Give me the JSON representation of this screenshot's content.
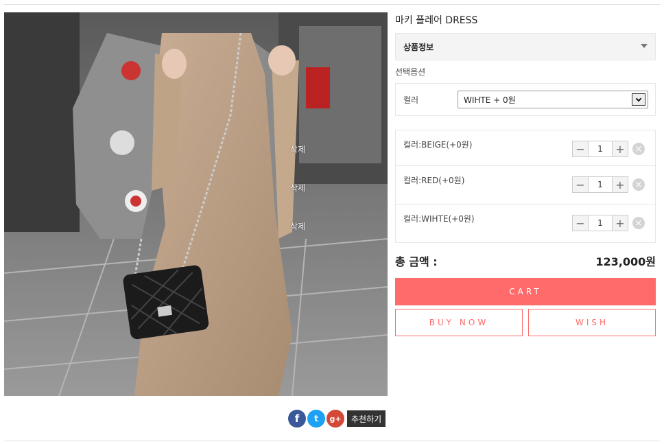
{
  "product": {
    "title": "마키 플레어 DRESS",
    "photo_alt": "product photo"
  },
  "photo_overlay": {
    "delete_labels": [
      "삭제",
      "삭제",
      "삭제"
    ]
  },
  "info_toggle": {
    "label": "상품정보"
  },
  "options": {
    "heading": "선택옵션",
    "color_label": "컬러",
    "color_selected": "WIHTE  + 0원"
  },
  "selected_items": [
    {
      "name": "컬러:BEIGE(+0원)",
      "qty": "1",
      "minus": "−",
      "plus": "+",
      "remove": "×"
    },
    {
      "name": "컬러:RED(+0원)",
      "qty": "1",
      "minus": "−",
      "plus": "+",
      "remove": "×"
    },
    {
      "name": "컬러:WIHTE(+0원)",
      "qty": "1",
      "minus": "−",
      "plus": "+",
      "remove": "×"
    }
  ],
  "total": {
    "label": "총 금액 :",
    "value": "123,000원"
  },
  "actions": {
    "cart": "CART",
    "buy_now": "BUY NOW",
    "wish": "WISH"
  },
  "share": {
    "facebook_glyph": "f",
    "twitter_glyph": "t",
    "google_glyph": "g+",
    "recommend_label": "추천하기"
  },
  "colors": {
    "accent": "#ff6b6b",
    "facebook": "#3b5998",
    "twitter": "#1da1f2",
    "google": "#d34836"
  }
}
